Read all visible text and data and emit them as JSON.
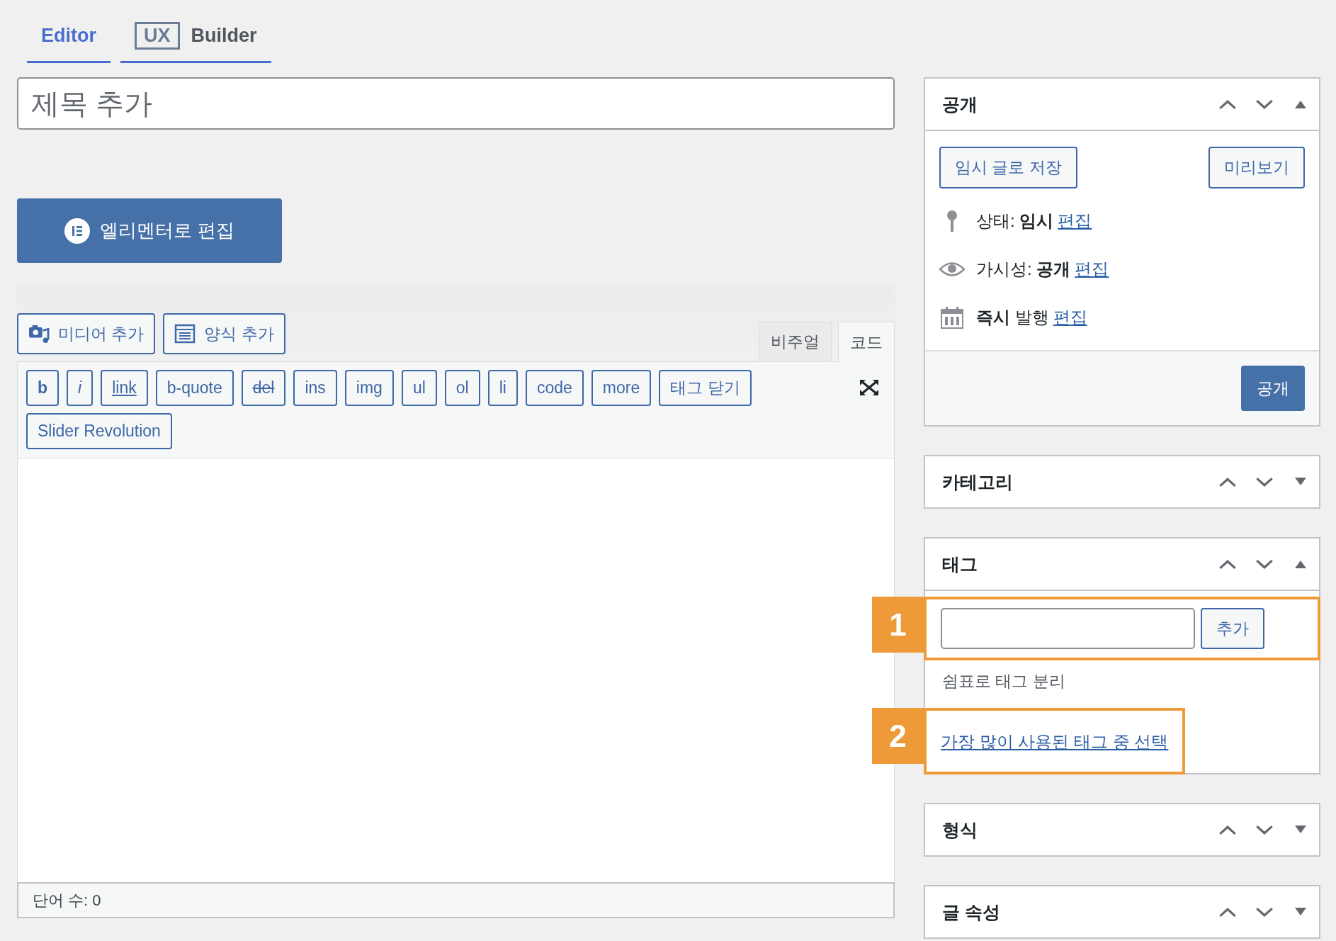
{
  "tabs": [
    {
      "label": "Editor",
      "selected": true
    },
    {
      "badge": "UX",
      "label": "Builder",
      "selected": false
    }
  ],
  "title_field": {
    "placeholder": "제목 추가"
  },
  "elementor_button": {
    "label": "엘리멘터로 편집"
  },
  "media_buttons": [
    {
      "label": "미디어 추가",
      "kind": "media"
    },
    {
      "label": "양식 추가",
      "kind": "form"
    }
  ],
  "editor_tabs": [
    {
      "label": "비주얼",
      "selected": false
    },
    {
      "label": "코드",
      "selected": true
    }
  ],
  "quicktags": [
    {
      "label": "b",
      "kind": "bold"
    },
    {
      "label": "i",
      "kind": "italic"
    },
    {
      "label": "link",
      "kind": "underline"
    },
    {
      "label": "b-quote",
      "kind": "plain"
    },
    {
      "label": "del",
      "kind": "strike"
    },
    {
      "label": "ins",
      "kind": "plain"
    },
    {
      "label": "img",
      "kind": "plain"
    },
    {
      "label": "ul",
      "kind": "plain"
    },
    {
      "label": "ol",
      "kind": "plain"
    },
    {
      "label": "li",
      "kind": "plain"
    },
    {
      "label": "code",
      "kind": "plain"
    },
    {
      "label": "more",
      "kind": "plain"
    },
    {
      "label": "태그 닫기",
      "kind": "plain"
    },
    {
      "label": "Slider Revolution",
      "kind": "plain"
    }
  ],
  "word_count": "단어 수: 0",
  "sidebar": {
    "panels": [
      {
        "kind": "publish",
        "title": "공개",
        "expanded": true,
        "buttons": [
          "임시 글로 저장",
          "미리보기"
        ],
        "rows": [
          {
            "kind": "status",
            "text": "상태: **임시**",
            "link": "편집"
          },
          {
            "kind": "visibility",
            "text": "가시성: **공개**",
            "link": "편집"
          },
          {
            "kind": "schedule",
            "text": "**즉시** 발행",
            "link": "편집"
          }
        ],
        "publish_button": "공개"
      },
      {
        "kind": "plain",
        "title": "카테고리",
        "expanded": false
      },
      {
        "kind": "tags",
        "title": "태그",
        "expanded": true,
        "add_button": "추가",
        "hint": "쉼표로 태그 분리",
        "link": "가장 많이 사용된 태그 중 선택",
        "annotations": [
          "1",
          "2"
        ]
      },
      {
        "kind": "plain",
        "title": "형식",
        "expanded": false
      },
      {
        "kind": "plain",
        "title": "글 속성",
        "expanded": false
      }
    ]
  }
}
